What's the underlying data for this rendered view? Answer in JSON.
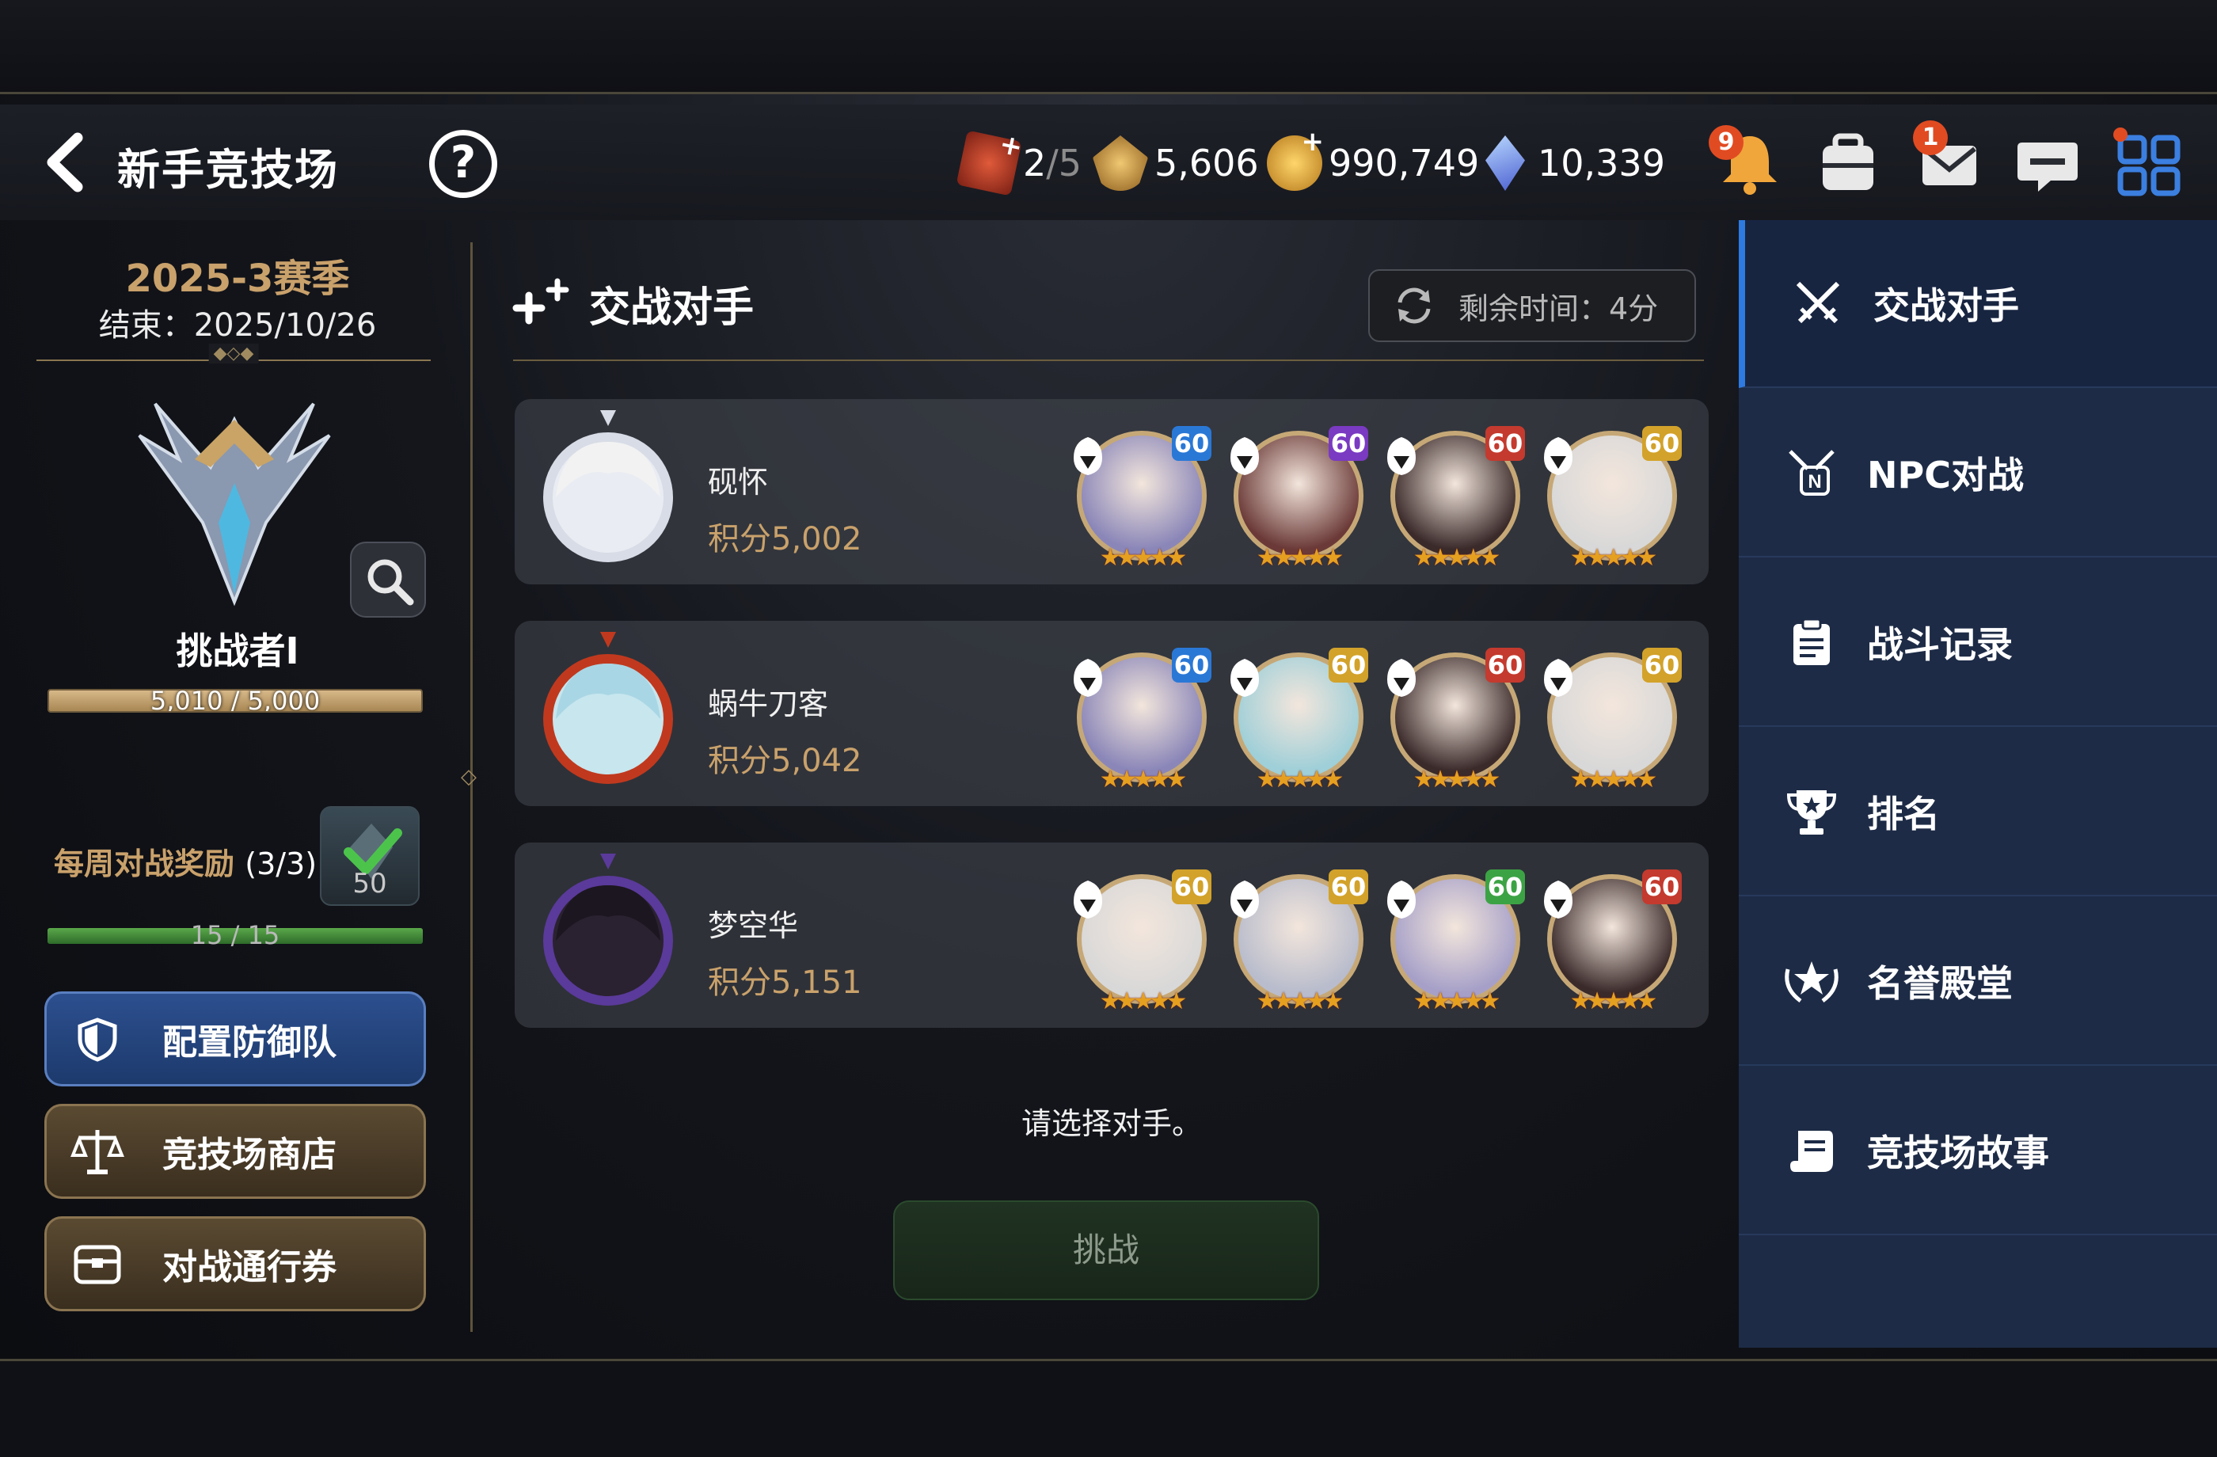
{
  "header": {
    "title": "新手竞技场",
    "help_label": "?",
    "resources": [
      {
        "icon": "battle-ticket-icon",
        "value": "2",
        "max": "/5",
        "color": "#c0392b"
      },
      {
        "icon": "arena-coin-icon",
        "value": "5,606",
        "color": "#d4a24a"
      },
      {
        "icon": "gold-coin-icon",
        "value": "990,749",
        "color": "#e2a528"
      },
      {
        "icon": "crystal-icon",
        "value": "10,339",
        "color": "#5b7bd6"
      }
    ],
    "badges": {
      "notifications": "9",
      "mail": "1"
    }
  },
  "left": {
    "season": "2025-3赛季",
    "season_end": "结束：2025/10/26",
    "rank_name": "挑战者Ⅰ",
    "rank_progress_text": "5,010 / 5,000",
    "rank_progress": 1.0,
    "weekly_label": "每周对战奖励",
    "weekly_count": "(3/3)",
    "weekly_reward_value": "50",
    "weekly_progress_text": "15 / 15",
    "weekly_progress": 1.0,
    "buttons": {
      "defense": "配置防御队",
      "shop": "竞技场商店",
      "pass": "对战通行券"
    }
  },
  "center": {
    "section_title": "交战对手",
    "timer": "剩余时间：4分",
    "prompt": "请选择对手。",
    "challenge": "挑战",
    "opponents": [
      {
        "name": "砚怀",
        "score": "积分5,002",
        "heroes": [
          {
            "level": "60",
            "badge": "blue",
            "stars": "★★★★★",
            "color": "#8a86b8"
          },
          {
            "level": "60",
            "badge": "purple",
            "stars": "★★★★★",
            "color": "#6b3a38"
          },
          {
            "level": "60",
            "badge": "red",
            "stars": "★★★★★",
            "color": "#3a2a2a"
          },
          {
            "level": "60",
            "badge": "gold",
            "stars": "★★★★★",
            "color": "#d8d8d8"
          }
        ]
      },
      {
        "name": "蜗牛刀客",
        "score": "积分5,042",
        "heroes": [
          {
            "level": "60",
            "badge": "blue",
            "stars": "★★★★★",
            "color": "#8a86b8"
          },
          {
            "level": "60",
            "badge": "gold",
            "stars": "★★★★★",
            "color": "#9fcfd8"
          },
          {
            "level": "60",
            "badge": "red",
            "stars": "★★★★★",
            "color": "#3a2a2a"
          },
          {
            "level": "60",
            "badge": "gold",
            "stars": "★★★★★",
            "color": "#d8d8d8"
          }
        ]
      },
      {
        "name": "梦空华",
        "score": "积分5,151",
        "heroes": [
          {
            "level": "60",
            "badge": "gold",
            "stars": "★★★★★",
            "color": "#d8d8d8"
          },
          {
            "level": "60",
            "badge": "gold",
            "stars": "★★★★★",
            "color": "#b8bccc"
          },
          {
            "level": "60",
            "badge": "green",
            "stars": "★★★★★",
            "color": "#a6a0c8"
          },
          {
            "level": "60",
            "badge": "red",
            "stars": "★★★★★",
            "color": "#3a2a2a"
          }
        ]
      }
    ]
  },
  "rnav": {
    "items": [
      {
        "label": "交战对手",
        "icon": "crossed-swords-icon",
        "active": true
      },
      {
        "label": "NPC对战",
        "icon": "npc-battle-icon",
        "active": false
      },
      {
        "label": "战斗记录",
        "icon": "clipboard-icon",
        "active": false
      },
      {
        "label": "排名",
        "icon": "trophy-icon",
        "active": false
      },
      {
        "label": "名誉殿堂",
        "icon": "laurel-star-icon",
        "active": false
      },
      {
        "label": "竞技场故事",
        "icon": "scroll-icon",
        "active": false
      }
    ]
  }
}
